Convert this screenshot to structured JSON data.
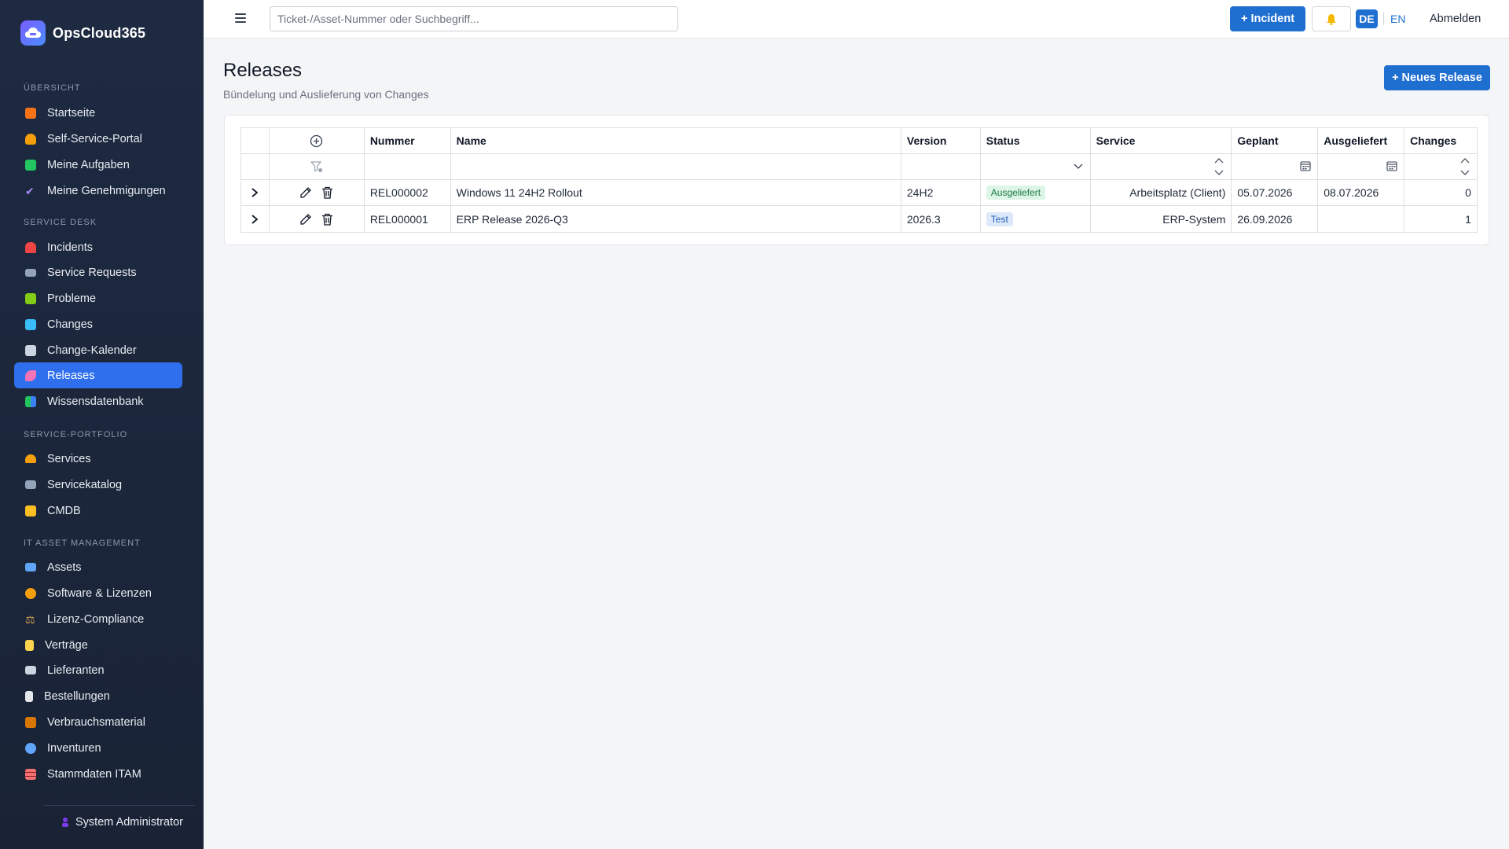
{
  "app": {
    "brand": "OpsCloud365"
  },
  "sidebar": {
    "sections": [
      {
        "title": "ÜBERSICHT"
      },
      {
        "title": "SERVICE DESK"
      },
      {
        "title": "SERVICE-PORTFOLIO"
      },
      {
        "title": "IT ASSET MANAGEMENT"
      }
    ],
    "items": [
      {
        "label": "Startseite",
        "icon": "house-icon",
        "color": "#f97316"
      },
      {
        "label": "Self-Service-Portal",
        "icon": "person-icon",
        "color": "#f59e0b"
      },
      {
        "label": "Meine Aufgaben",
        "icon": "check-box-icon",
        "color": "#22c55e"
      },
      {
        "label": "Meine Genehmigungen",
        "icon": "checkmark-icon",
        "color": "#a78bfa"
      },
      {
        "label": "Incidents",
        "icon": "siren-icon",
        "color": "#ef4444"
      },
      {
        "label": "Service Requests",
        "icon": "envelope-icon",
        "color": "#94a3b8"
      },
      {
        "label": "Probleme",
        "icon": "puzzle-icon",
        "color": "#84cc16"
      },
      {
        "label": "Changes",
        "icon": "refresh-icon",
        "color": "#38bdf8"
      },
      {
        "label": "Change-Kalender",
        "icon": "calendar-icon",
        "color": "#cbd5e1"
      },
      {
        "label": "Releases",
        "icon": "rocket-icon",
        "color": "#f472b6"
      },
      {
        "label": "Wissensdatenbank",
        "icon": "books-icon",
        "color": "#22c55e"
      },
      {
        "label": "Services",
        "icon": "bell-service-icon",
        "color": "#f59e0b"
      },
      {
        "label": "Servicekatalog",
        "icon": "monitor-icon",
        "color": "#94a3b8"
      },
      {
        "label": "CMDB",
        "icon": "folder-icon",
        "color": "#fbbf24"
      },
      {
        "label": "Assets",
        "icon": "laptop-icon",
        "color": "#60a5fa"
      },
      {
        "label": "Software & Lizenzen",
        "icon": "disc-icon",
        "color": "#f59e0b"
      },
      {
        "label": "Lizenz-Compliance",
        "icon": "scales-icon",
        "color": "#d1a054"
      },
      {
        "label": "Verträge",
        "icon": "scroll-icon",
        "color": "#fcd34d"
      },
      {
        "label": "Lieferanten",
        "icon": "truck-icon",
        "color": "#cbd5e1"
      },
      {
        "label": "Bestellungen",
        "icon": "receipt-icon",
        "color": "#e5e7eb"
      },
      {
        "label": "Verbrauchsmaterial",
        "icon": "package-icon",
        "color": "#d97706"
      },
      {
        "label": "Inventuren",
        "icon": "magnifier-icon",
        "color": "#60a5fa"
      },
      {
        "label": "Stammdaten ITAM",
        "icon": "bricks-icon",
        "color": "#f87171"
      }
    ],
    "user": "System Administrator"
  },
  "topbar": {
    "search_placeholder": "Ticket-/Asset-Nummer oder Suchbegriff...",
    "incident_button": "+ Incident",
    "lang_de": "DE",
    "lang_en": "EN",
    "logout": "Abmelden"
  },
  "main": {
    "title": "Releases",
    "subtitle": "Bündelung und Auslieferung von Changes",
    "new_button": "+ Neues Release"
  },
  "table": {
    "columns": [
      "Nummer",
      "Name",
      "Version",
      "Status",
      "Service",
      "Geplant",
      "Ausgeliefert",
      "Changes"
    ],
    "rows": [
      {
        "nummer": "REL000002",
        "name": "Windows 11 24H2 Rollout",
        "version": "24H2",
        "status": "Ausgeliefert",
        "service": "Arbeitsplatz (Client)",
        "geplant": "05.07.2026",
        "ausgeliefert": "08.07.2026",
        "changes": "0"
      },
      {
        "nummer": "REL000001",
        "name": "ERP Release 2026-Q3",
        "version": "2026.3",
        "status": "Test",
        "service": "ERP-System",
        "geplant": "26.09.2026",
        "ausgeliefert": "",
        "changes": "1"
      }
    ]
  },
  "colors": {
    "accent": "#1f6fd1",
    "sidebar_active": "#2f6fed",
    "sidebar_bg": "#1d2a41"
  }
}
